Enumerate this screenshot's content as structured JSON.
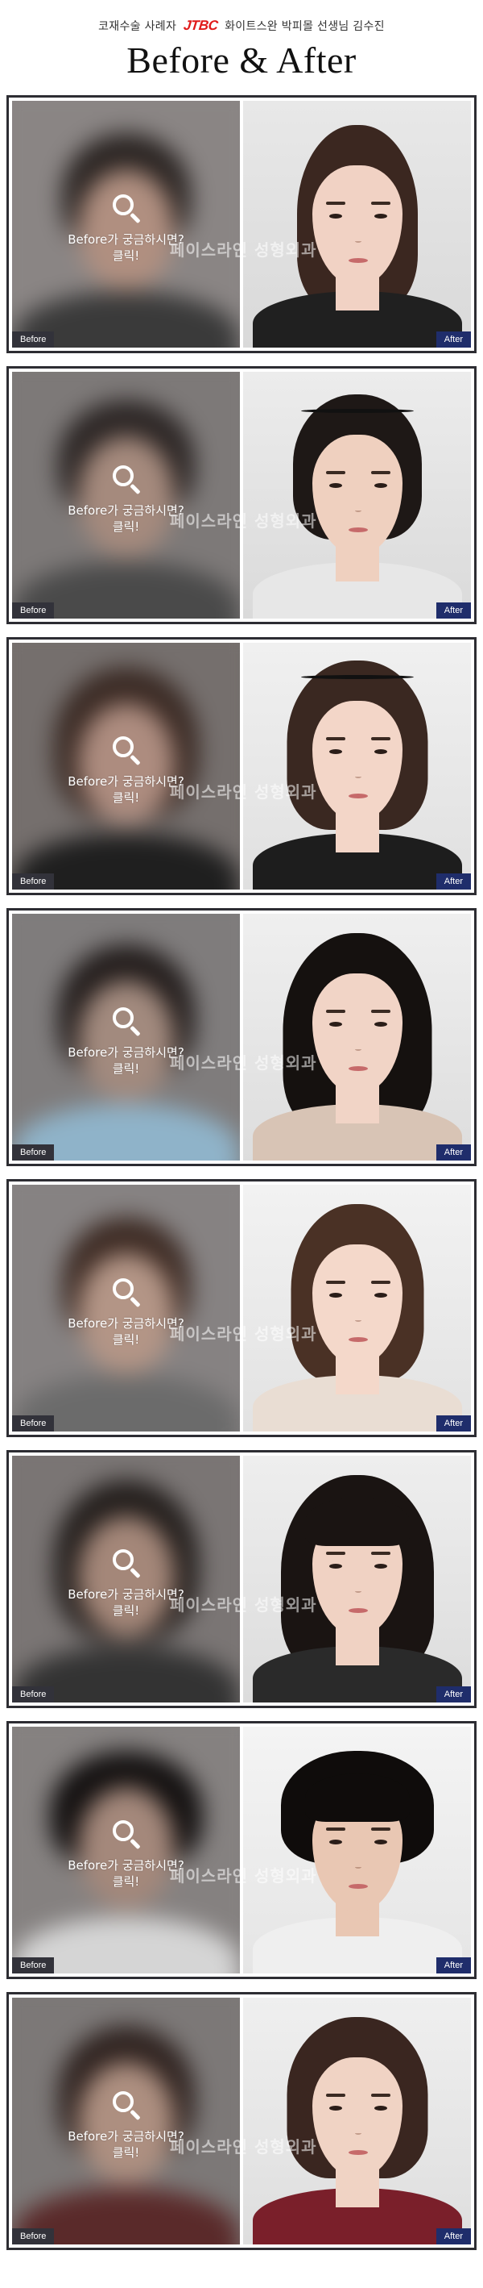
{
  "header": {
    "subtitle_left": "코재수술 사례자",
    "subtitle_logo": "JTBC",
    "subtitle_right": "화이트스완 박피몰 선생님 김수진",
    "title": "Before & After"
  },
  "labels": {
    "before": "Before",
    "after": "After",
    "hint_line1": "Before가 궁금하시면?",
    "hint_line2": "클릭!",
    "watermark": "페이스라인 성형외과"
  },
  "icons": {
    "magnifier": "search-icon"
  },
  "colors": {
    "frame": "#2d2d33",
    "before_tag": "#32323a",
    "after_tag": "#1f2d6b",
    "jtbc_red": "#e01a1a"
  },
  "cases": [
    {
      "id": 1
    },
    {
      "id": 2
    },
    {
      "id": 3
    },
    {
      "id": 4
    },
    {
      "id": 5
    },
    {
      "id": 6
    },
    {
      "id": 7
    },
    {
      "id": 8
    }
  ]
}
